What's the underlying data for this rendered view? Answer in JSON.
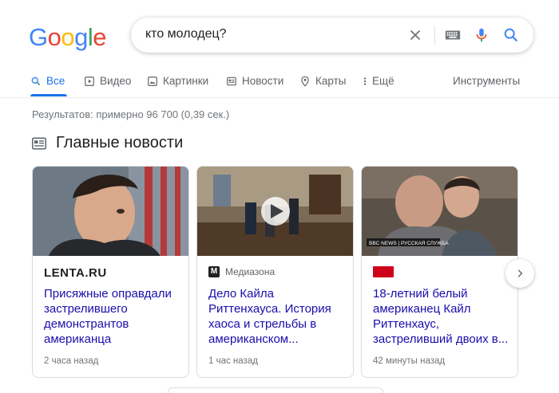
{
  "logo": {
    "letters": [
      "G",
      "o",
      "o",
      "g",
      "l",
      "e"
    ],
    "colors": [
      "#4285f4",
      "#ea4335",
      "#fbbc05",
      "#4285f4",
      "#34a853",
      "#ea4335"
    ]
  },
  "search": {
    "query": "кто молодец?"
  },
  "tabs": [
    {
      "label": "Все",
      "icon": "search-icon",
      "active": true
    },
    {
      "label": "Видео",
      "icon": "video-icon"
    },
    {
      "label": "Картинки",
      "icon": "image-icon"
    },
    {
      "label": "Новости",
      "icon": "news-icon"
    },
    {
      "label": "Карты",
      "icon": "map-pin-icon"
    },
    {
      "label": "Ещё",
      "icon": "more-vert-icon"
    }
  ],
  "tools_label": "Инструменты",
  "stats": "Результатов: примерно 96 700 (0,39 сек.)",
  "top_news_title": "Главные новости",
  "cards": [
    {
      "source": "LENTA.RU",
      "headline": "Присяжные оправдали застрелившего демонстрантов американца",
      "time": "2 часа назад"
    },
    {
      "source": "Медиазона",
      "source_logo": "M",
      "headline": "Дело Кайла Риттенхауса. История хаоса и стрельбы в американском...",
      "time": "1 час назад"
    },
    {
      "source_logo_color": "#d0021b",
      "image_caption": "BBC NEWS | РУССКАЯ СЛУЖБА",
      "headline": "18-летний белый американец Кайл Риттенхаус, застреливший двоих в...",
      "time": "42 минуты назад"
    }
  ],
  "colors": {
    "accent": "#1a73e8",
    "link": "#1a0dab"
  }
}
